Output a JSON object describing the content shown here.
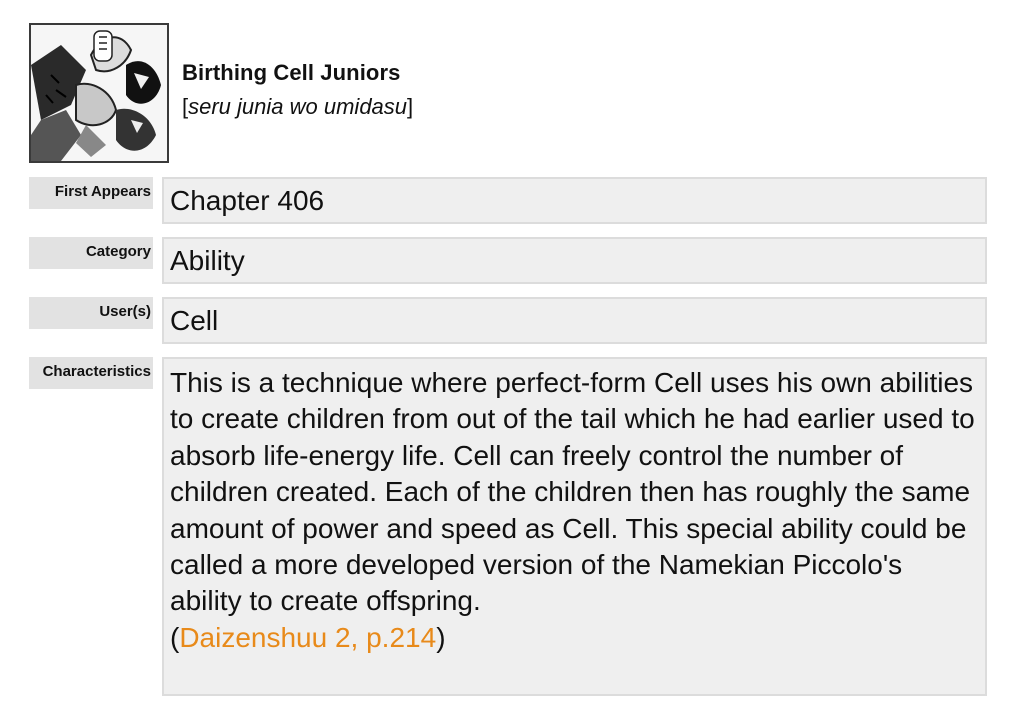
{
  "header": {
    "title": "Birthing Cell Juniors",
    "subtitle_open": "[",
    "subtitle_romaji": "seru junia wo umidasu",
    "subtitle_close": "]"
  },
  "fields": {
    "first_appears": {
      "label": "First Appears",
      "value": "Chapter 406"
    },
    "category": {
      "label": "Category",
      "value": "Ability"
    },
    "users": {
      "label": "User(s)",
      "value": "Cell"
    },
    "characteristics": {
      "label": "Characteristics",
      "text": "This is a technique where perfect-form Cell uses his own abilities to create children from out of the tail which he had earlier used to absorb life-energy life. Cell can freely control the number of children created. Each of the children then has roughly the same amount of power and speed as Cell. This special ability could be called a more developed version of the Namekian Piccolo's ability to create offspring.",
      "source_open": "(",
      "source_link": "Daizenshuu 2, p.214",
      "source_close": ")"
    }
  },
  "colors": {
    "link": "#e88a1a",
    "label_bg": "#e2e2e2",
    "value_bg": "#efefef"
  }
}
